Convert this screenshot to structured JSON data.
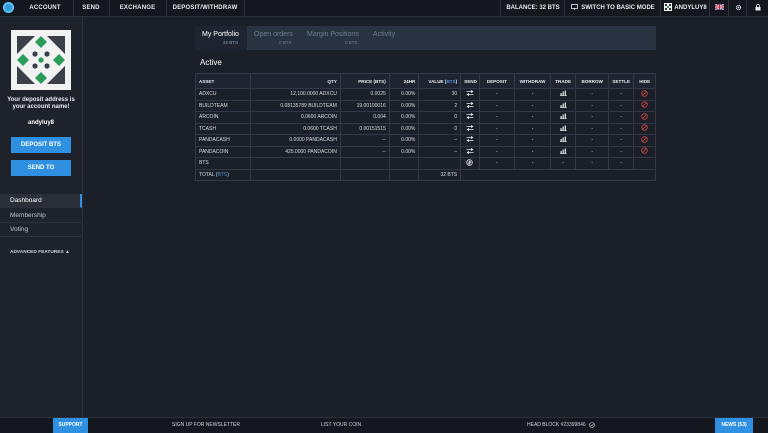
{
  "topnav": {
    "items": [
      {
        "label": "ACCOUNT"
      },
      {
        "label": "SEND"
      },
      {
        "label": "EXCHANGE"
      },
      {
        "label": "DEPOSIT/WITHDRAW"
      }
    ],
    "balance_label": "BALANCE: 32 BTS",
    "basic_mode_label": "SWITCH TO BASIC MODE",
    "username": "ANDYLUY8"
  },
  "sidebar": {
    "deposit_text": "Your deposit address is your account name!",
    "account_name": "andyluy8",
    "deposit_button": "DEPOSIT BTS",
    "send_button": "SEND TO",
    "nav": [
      {
        "label": "Dashboard",
        "active": true
      },
      {
        "label": "Membership",
        "active": false
      },
      {
        "label": "Voting",
        "active": false
      }
    ],
    "advanced_label": "ADVANCED FEATURES ▲"
  },
  "tabs": [
    {
      "label": "My Portfolio",
      "sub": "32 BTS",
      "active": true
    },
    {
      "label": "Open orders",
      "sub": "0 BTS",
      "active": false
    },
    {
      "label": "Margin Positions",
      "sub": "0 BTS",
      "active": false
    },
    {
      "label": "Activity",
      "sub": "",
      "active": false
    }
  ],
  "section_title": "Active",
  "table": {
    "headers": {
      "asset": "ASSET",
      "qty": "QTY",
      "price": "PRICE (BTS)",
      "h24": "24HR",
      "value_prefix": "VALUE (",
      "value_unit": "BTS",
      "value_suffix": ")",
      "send": "SEND",
      "deposit": "DEPOSIT",
      "withdraw": "WITHDRAW",
      "trade": "TRADE",
      "borrow": "BORROW",
      "settle": "SETTLE",
      "hide": "HIDE"
    },
    "rows": [
      {
        "asset": "ADXCU",
        "qty": "12,100.0000 ADXCU",
        "price": "0.0025",
        "h24": "0.00%",
        "value": "30",
        "send": "transfer",
        "deposit": "-",
        "withdraw": "-",
        "trade": "chart",
        "borrow": "-",
        "settle": "-",
        "hide": "hide"
      },
      {
        "asset": "BUILDTEAM",
        "qty": "0.08135789 BUILDTEAM",
        "price": "19.00100016",
        "h24": "0.00%",
        "value": "2",
        "send": "transfer",
        "deposit": "-",
        "withdraw": "-",
        "trade": "chart",
        "borrow": "-",
        "settle": "-",
        "hide": "hide"
      },
      {
        "asset": "ARCOIN",
        "qty": "0.0600 ARCOIN",
        "price": "0.004",
        "h24": "0.00%",
        "value": "0",
        "send": "transfer",
        "deposit": "-",
        "withdraw": "-",
        "trade": "chart",
        "borrow": "-",
        "settle": "-",
        "hide": "hide"
      },
      {
        "asset": "TCASH",
        "qty": "0.0600 TCASH",
        "price": "0.00151515",
        "h24": "0.00%",
        "value": "0",
        "send": "transfer",
        "deposit": "-",
        "withdraw": "-",
        "trade": "chart",
        "borrow": "-",
        "settle": "-",
        "hide": "hide"
      },
      {
        "asset": "PANDACASH",
        "qty": "0.0000 PANDACASH",
        "price": "--",
        "h24": "0.00%",
        "value": "--",
        "send": "transfer",
        "deposit": "-",
        "withdraw": "-",
        "trade": "chart",
        "borrow": "-",
        "settle": "-",
        "hide": "hide"
      },
      {
        "asset": "PANDACOIN",
        "qty": "425.0000 PANDACOIN",
        "price": "--",
        "h24": "0.00%",
        "value": "--",
        "send": "transfer",
        "deposit": "-",
        "withdraw": "-",
        "trade": "chart",
        "borrow": "-",
        "settle": "-",
        "hide": "hide"
      },
      {
        "asset": "BTS",
        "qty": "",
        "price": "",
        "h24": "",
        "value": "",
        "send": "settle",
        "deposit": "-",
        "withdraw": "-",
        "trade": "-",
        "borrow": "-",
        "settle": "-",
        "hide": ""
      }
    ],
    "total": {
      "prefix": "TOTAL (",
      "unit": "BTS",
      "suffix": ")",
      "value": "32 BTS"
    }
  },
  "footer": {
    "support": "SUPPORT",
    "newsletter": "SIGN UP FOR NEWSLETTER",
    "list_coin": "LIST YOUR COIN",
    "head_block": "HEAD BLOCK #23399846",
    "news": "NEWS (53)"
  },
  "colors": {
    "accent": "#2f8fe0",
    "link": "#4a8fd9",
    "hide_red": "#d24646",
    "total_green": "#66a56a"
  }
}
